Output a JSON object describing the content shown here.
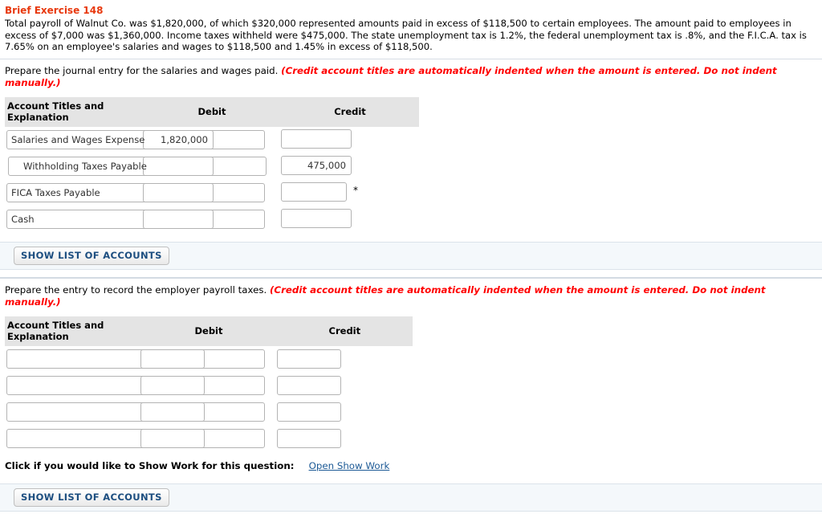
{
  "exercise": {
    "title": "Brief Exercise 148",
    "problem": "Total payroll of Walnut Co. was $1,820,000, of which $320,000 represented amounts paid in excess of $118,500 to certain employees. The amount paid to employees in excess of $7,000 was $1,360,000. Income taxes withheld were $475,000. The state unemployment tax is 1.2%, the federal unemployment tax is .8%, and the F.I.C.A. tax is 7.65% on an employee's salaries and wages to $118,500 and 1.45% in excess of $118,500."
  },
  "part1": {
    "prompt": "Prepare the journal entry for the salaries and wages paid.",
    "hint": "(Credit account titles are automatically indented when the amount is entered. Do not indent manually.)",
    "columns": {
      "account": "Account Titles and Explanation",
      "debit": "Debit",
      "credit": "Credit"
    },
    "rows": [
      {
        "account": "Salaries and Wages Expense",
        "indent": false,
        "debit": "1,820,000",
        "credit": "",
        "star": false
      },
      {
        "account": "Withholding Taxes Payable",
        "indent": true,
        "debit": "",
        "credit": "475,000",
        "star": false
      },
      {
        "account": "FICA Taxes Payable",
        "indent": false,
        "debit": "",
        "credit": "",
        "star": true
      },
      {
        "account": "Cash",
        "indent": false,
        "debit": "",
        "credit": "",
        "star": false
      }
    ],
    "accounts_button": "SHOW LIST OF ACCOUNTS"
  },
  "part2": {
    "prompt": "Prepare the entry to record the employer payroll taxes.",
    "hint": "(Credit account titles are automatically indented when the amount is entered. Do not indent manually.)",
    "columns": {
      "account": "Account Titles and Explanation",
      "debit": "Debit",
      "credit": "Credit"
    },
    "rows": [
      {
        "account": "",
        "indent": false,
        "debit": "",
        "credit": ""
      },
      {
        "account": "",
        "indent": false,
        "debit": "",
        "credit": ""
      },
      {
        "account": "",
        "indent": false,
        "debit": "",
        "credit": ""
      },
      {
        "account": "",
        "indent": false,
        "debit": "",
        "credit": ""
      }
    ],
    "accounts_button": "SHOW LIST OF ACCOUNTS"
  },
  "showwork": {
    "label": "Click if you would like to Show Work for this question:",
    "link": "Open Show Work"
  },
  "symbols": {
    "star": "*"
  },
  "colors": {
    "title_red": "#e8380d",
    "hint_red": "#ff0000",
    "link_blue": "#1d5a96",
    "button_blue": "#1c4e80",
    "header_band": "#e4e4e4",
    "accounts_band": "#f4f8fb"
  }
}
